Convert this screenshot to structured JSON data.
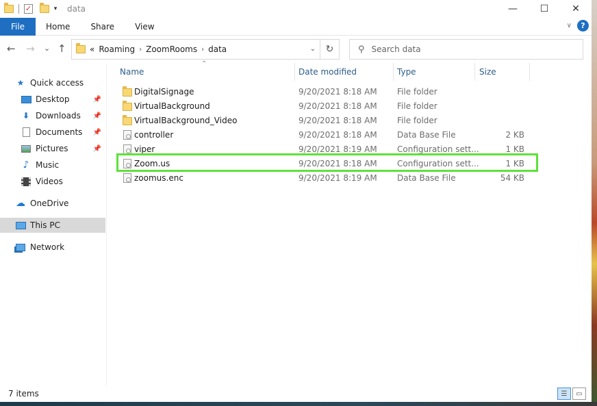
{
  "window": {
    "title": "data",
    "controls": {
      "minimize": "—",
      "maximize": "☐",
      "close": "✕"
    }
  },
  "ribbon": {
    "tabs": [
      "File",
      "Home",
      "Share",
      "View"
    ],
    "collapse_glyph": "∨",
    "help_glyph": "?"
  },
  "nav": {
    "back": "←",
    "forward": "→",
    "recent": "⌄",
    "up": "↑",
    "breadcrumb_prefix": "«",
    "breadcrumb": [
      "Roaming",
      "ZoomRooms",
      "data"
    ],
    "breadcrumb_sep": "›",
    "dropdown": "⌄",
    "refresh": "↻"
  },
  "search": {
    "placeholder": "Search data",
    "value": ""
  },
  "sidebar": {
    "items": [
      {
        "label": "Quick access",
        "icon": "star-icon",
        "pinned": false
      },
      {
        "label": "Desktop",
        "icon": "desktop-icon",
        "pinned": true
      },
      {
        "label": "Downloads",
        "icon": "download-icon",
        "pinned": true
      },
      {
        "label": "Documents",
        "icon": "document-icon",
        "pinned": true
      },
      {
        "label": "Pictures",
        "icon": "picture-icon",
        "pinned": true
      },
      {
        "label": "Music",
        "icon": "music-icon",
        "pinned": false
      },
      {
        "label": "Videos",
        "icon": "video-icon",
        "pinned": false
      },
      {
        "label": "OneDrive",
        "icon": "cloud-icon",
        "pinned": false
      },
      {
        "label": "This PC",
        "icon": "computer-icon",
        "pinned": false,
        "selected": true
      },
      {
        "label": "Network",
        "icon": "network-icon",
        "pinned": false
      }
    ]
  },
  "columns": [
    "Name",
    "Date modified",
    "Type",
    "Size"
  ],
  "files": [
    {
      "name": "DigitalSignage",
      "date": "9/20/2021 8:18 AM",
      "type": "File folder",
      "size": "",
      "kind": "folder"
    },
    {
      "name": "VirtualBackground",
      "date": "9/20/2021 8:18 AM",
      "type": "File folder",
      "size": "",
      "kind": "folder"
    },
    {
      "name": "VirtualBackground_Video",
      "date": "9/20/2021 8:18 AM",
      "type": "File folder",
      "size": "",
      "kind": "folder"
    },
    {
      "name": "controller",
      "date": "9/20/2021 8:18 AM",
      "type": "Data Base File",
      "size": "2 KB",
      "kind": "file"
    },
    {
      "name": "viper",
      "date": "9/20/2021 8:19 AM",
      "type": "Configuration sett...",
      "size": "1 KB",
      "kind": "file"
    },
    {
      "name": "Zoom.us",
      "date": "9/20/2021 8:18 AM",
      "type": "Configuration sett...",
      "size": "1 KB",
      "kind": "file",
      "highlighted": true
    },
    {
      "name": "zoomus.enc",
      "date": "9/20/2021 8:19 AM",
      "type": "Data Base File",
      "size": "54 KB",
      "kind": "file"
    }
  ],
  "status": {
    "item_count": "7 items"
  },
  "colors": {
    "accent": "#1e6fc2",
    "highlight": "#5ee13a",
    "header_text": "#2b5c8a"
  }
}
